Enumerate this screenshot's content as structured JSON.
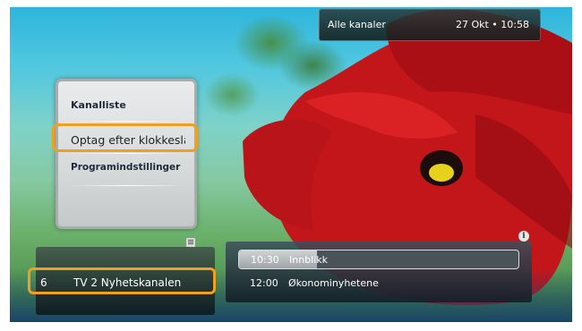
{
  "header": {
    "channel_group": "Alle kanaler",
    "datetime": "27 Okt • 10:58"
  },
  "menu": {
    "items": [
      {
        "label": "Kanalliste"
      },
      {
        "label": "Optag efter klokkeslæt",
        "selected": true
      },
      {
        "label": "Programindstillinger"
      }
    ]
  },
  "channel": {
    "number": "6",
    "name": "TV 2 Nyhetskanalen"
  },
  "epg": {
    "rows": [
      {
        "time": "10:30",
        "title": "Innblikk",
        "progress": 0.28
      },
      {
        "time": "12:00",
        "title": "Økonominyhetene"
      }
    ]
  },
  "icons": {
    "list": "list-icon",
    "info": "info-icon"
  },
  "colors": {
    "selection": "#f0a020",
    "flower": "#d01818"
  }
}
